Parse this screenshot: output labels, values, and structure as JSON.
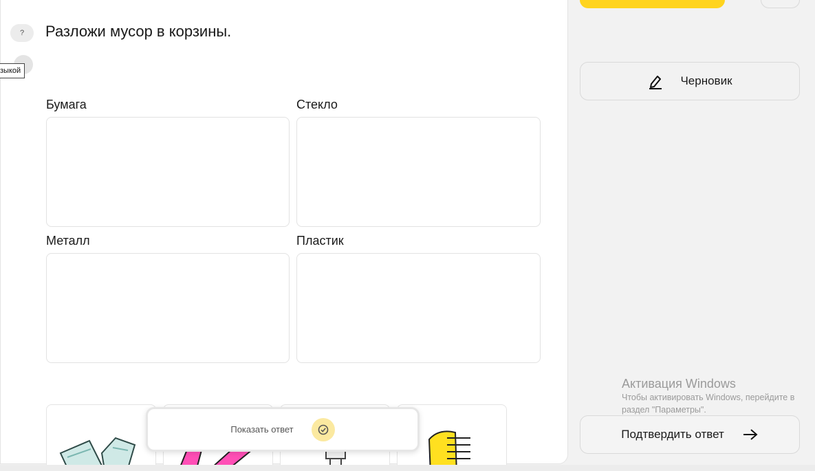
{
  "task": {
    "help_glyph": "?",
    "tooltip": "зыкой",
    "question": "Разложи мусор в корзины."
  },
  "baskets": [
    {
      "label": "Бумага"
    },
    {
      "label": "Стекло"
    },
    {
      "label": "Металл"
    },
    {
      "label": "Пластик"
    }
  ],
  "items": [
    {
      "icon": "glass-shards-icon"
    },
    {
      "icon": "pink-plastic-icon"
    },
    {
      "icon": "glass-bottle-icon"
    },
    {
      "icon": "yellow-comb-icon"
    }
  ],
  "show_answer": {
    "label": "Показать ответ",
    "icon": "check-circle-icon"
  },
  "sidebar": {
    "draft_label": "Черновик",
    "draft_icon": "pencil-icon",
    "confirm_label": "Подтвердить ответ",
    "confirm_icon": "arrow-right-icon"
  },
  "windows_watermark": {
    "title": "Активация Windows",
    "line1": "Чтобы активировать Windows, перейдите в",
    "line2": "раздел \"Параметры\"."
  },
  "colors": {
    "accent": "#ffd41f",
    "check_bg": "#fbe9a0",
    "page_bg": "#f2f2f2"
  }
}
